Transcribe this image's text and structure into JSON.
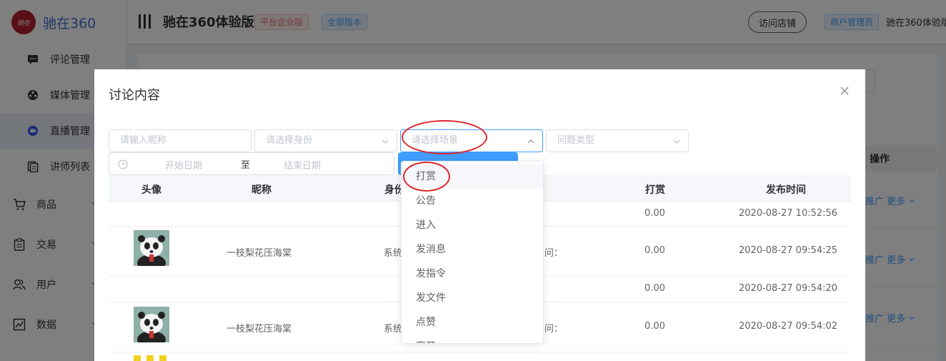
{
  "brand": {
    "logo_text": "驰在360",
    "logo_mark": "驰在"
  },
  "sidebar": {
    "sub_items": [
      {
        "label": "评论管理",
        "icon": "comment-icon"
      },
      {
        "label": "媒体管理",
        "icon": "film-reel-icon"
      },
      {
        "label": "直播管理",
        "icon": "live-camera-icon",
        "active": true
      },
      {
        "label": "讲师列表",
        "icon": "list-copy-icon"
      }
    ],
    "top_items": [
      {
        "label": "商品",
        "icon": "cart-icon"
      },
      {
        "label": "交易",
        "icon": "clipboard-icon"
      },
      {
        "label": "用户",
        "icon": "users-icon"
      },
      {
        "label": "数据",
        "icon": "chart-icon"
      }
    ]
  },
  "header": {
    "site_title": "驰在360体验版",
    "tag_edition": "平台企业版",
    "tag_versions": "全部版本",
    "visit_store": "访问店铺",
    "role": "商户管理员",
    "user_name": "驰在360体验版"
  },
  "background_table": {
    "op_header": "操作",
    "links": [
      "推广 更多",
      "推广 更多",
      "推广 更多"
    ]
  },
  "dialog": {
    "title": "讨论内容",
    "filters": {
      "nickname_placeholder": "请输入昵称",
      "identity_placeholder": "请选择身份",
      "scene_placeholder": "请选择场景",
      "question_type_placeholder": "问题类型",
      "start_date_placeholder": "开始日期",
      "date_separator": "至",
      "end_date_placeholder": "结束日期"
    },
    "table": {
      "headers": {
        "avatar": "头像",
        "nickname": "昵称",
        "identity": "身份",
        "reward": "打赏",
        "publish_time": "发布时间"
      },
      "rows": [
        {
          "avatar": false,
          "nickname": "",
          "identity": "",
          "content": "",
          "reward": "0.00",
          "time": "2020-08-27 10:52:56"
        },
        {
          "avatar": true,
          "nickname": "一枝梨花压海棠",
          "identity": "系统",
          "content": "问：",
          "reward": "0.00",
          "time": "2020-08-27 09:54:25"
        },
        {
          "avatar": false,
          "nickname": "",
          "identity": "",
          "content": "",
          "reward": "0.00",
          "time": "2020-08-27 09:54:20"
        },
        {
          "avatar": true,
          "nickname": "一枝梨花压海棠",
          "identity": "系统",
          "content": "问：",
          "reward": "0.00",
          "time": "2020-08-27 09:54:02"
        }
      ]
    },
    "scene_options": [
      "打赏",
      "公告",
      "进入",
      "发消息",
      "发指令",
      "发文件",
      "点赞",
      "离开"
    ]
  },
  "colors": {
    "accent": "#409eff",
    "annotation": "#e0242a",
    "brand_red": "#b3202a"
  }
}
